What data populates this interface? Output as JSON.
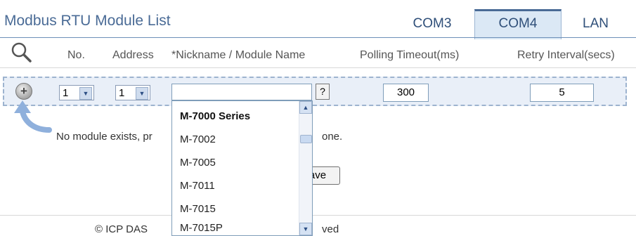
{
  "title": "Modbus RTU Module List",
  "tabs": [
    {
      "label": "COM3",
      "active": false
    },
    {
      "label": "COM4",
      "active": true
    },
    {
      "label": "LAN",
      "active": false
    }
  ],
  "headers": {
    "no": "No.",
    "address": "Address",
    "nickname": "*Nickname / Module Name",
    "polling": "Polling Timeout(ms)",
    "retry": "Retry Interval(secs)"
  },
  "row": {
    "no_value": "1",
    "address_value": "1",
    "nickname_value": "",
    "help_label": "?",
    "polling_value": "300",
    "retry_value": "5"
  },
  "message": "No module exists, pr",
  "message_end": "one.",
  "save_label": "ave",
  "footer_left": "© ICP DAS",
  "footer_right": "ved",
  "dropdown": {
    "group": "M-7000 Series",
    "items": [
      "M-7002",
      "M-7005",
      "M-7011",
      "M-7015",
      "M-7015P"
    ]
  },
  "colors": {
    "accent": "#4a6b96",
    "tab_active_bg": "#dbe8f5",
    "row_bg": "#e9eff8"
  },
  "icons": [
    "search-icon",
    "add-icon",
    "arrow-icon",
    "chevron-down-icon",
    "chevron-up-icon"
  ]
}
